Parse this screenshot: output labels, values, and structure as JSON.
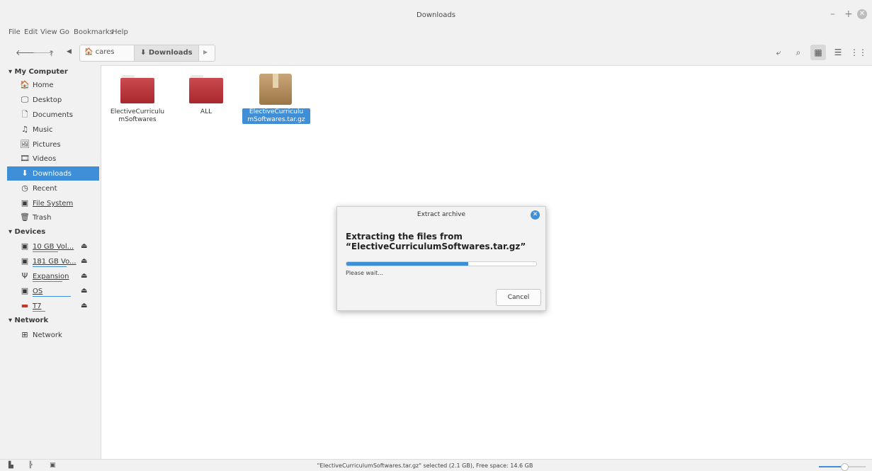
{
  "window": {
    "title": "Downloads"
  },
  "menu": [
    "File",
    "Edit",
    "View",
    "Go",
    "Bookmarks",
    "Help"
  ],
  "breadcrumbs": {
    "home": "cares",
    "current": "Downloads"
  },
  "sidebar": {
    "my_computer": "My Computer",
    "places": [
      "Home",
      "Desktop",
      "Documents",
      "Music",
      "Pictures",
      "Videos",
      "Downloads",
      "Recent",
      "File System",
      "Trash"
    ],
    "devices_heading": "Devices",
    "devices": [
      {
        "label": "10 GB Vol...",
        "usage": 0.6
      },
      {
        "label": "181 GB Vo...",
        "usage": 0.8
      },
      {
        "label": "Expansion",
        "usage": 0.7
      },
      {
        "label": "OS",
        "usage": 0.9
      },
      {
        "label": "T7",
        "usage": 0.3
      }
    ],
    "network_heading": "Network",
    "network": [
      "Network"
    ]
  },
  "files": [
    {
      "name": "ElectiveCurriculu\nmSoftwares",
      "type": "folder"
    },
    {
      "name": "ALL",
      "type": "folder"
    },
    {
      "name": "ElectiveCurriculu\nmSoftwares.tar.gz",
      "type": "archive",
      "selected": true
    }
  ],
  "dialog": {
    "title": "Extract archive",
    "heading": "Extracting the files from “ElectiveCurriculumSoftwares.tar.gz”",
    "progress": 0.64,
    "status": "Please wait...",
    "cancel": "Cancel"
  },
  "statusbar": {
    "text": "\"ElectiveCurriculumSoftwares.tar.gz\" selected (2.1 GB), Free space: 14.6 GB",
    "zoom": 0.55
  },
  "colors": {
    "accent": "#3f8fd8",
    "folder": "#b8343a"
  }
}
